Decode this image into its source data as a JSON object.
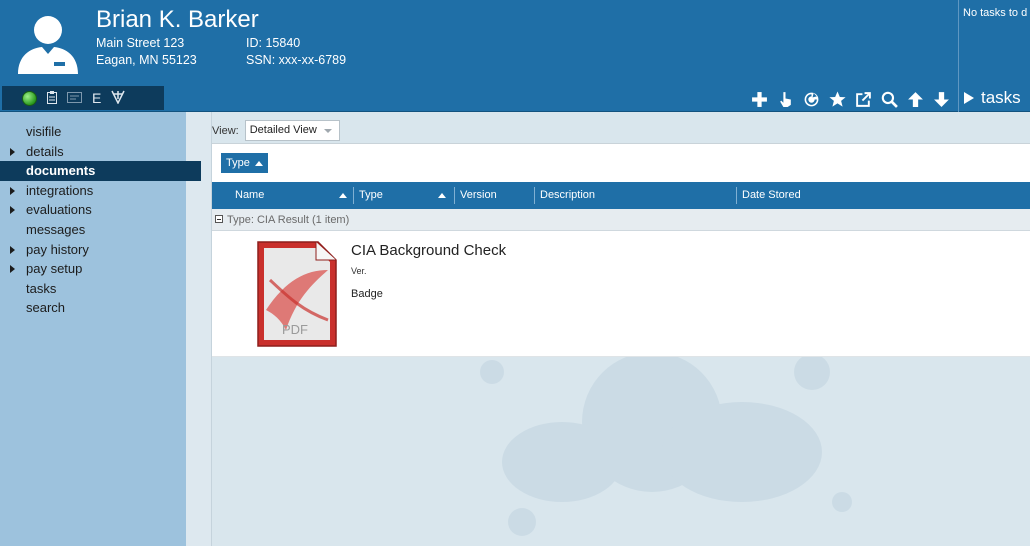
{
  "employee": {
    "name": "Brian K. Barker",
    "address_line1": "Main Street 123",
    "address_line2": "Eagan, MN 55123",
    "id_label": "ID:",
    "id_value": "15840",
    "ssn_label": "SSN:",
    "ssn_value": "xxx-xx-6789"
  },
  "status_bar": {
    "letter": "E"
  },
  "toolbar": [
    "add-icon",
    "pointer-icon",
    "refresh-icon",
    "star-icon",
    "export-icon",
    "search-icon",
    "arrow-up-icon",
    "arrow-down-icon"
  ],
  "tasks": {
    "message": "No tasks to d",
    "button_label": "tasks"
  },
  "sidebar": {
    "items": [
      {
        "label": "visifile",
        "expandable": false,
        "active": false
      },
      {
        "label": "details",
        "expandable": true,
        "active": false
      },
      {
        "label": "documents",
        "expandable": false,
        "active": true
      },
      {
        "label": "integrations",
        "expandable": true,
        "active": false
      },
      {
        "label": "evaluations",
        "expandable": true,
        "active": false
      },
      {
        "label": "messages",
        "expandable": false,
        "active": false
      },
      {
        "label": "pay history",
        "expandable": true,
        "active": false
      },
      {
        "label": "pay setup",
        "expandable": true,
        "active": false
      },
      {
        "label": "tasks",
        "expandable": false,
        "active": false
      },
      {
        "label": "search",
        "expandable": false,
        "active": false
      }
    ]
  },
  "view": {
    "label": "View:",
    "selected": "Detailed View"
  },
  "grid": {
    "group_chip": "Type",
    "columns": [
      "Name",
      "Type",
      "Version",
      "Description",
      "Date Stored"
    ],
    "group_row": "Type: CIA Result (1 item)",
    "document": {
      "title": "CIA Background Check",
      "version": "Ver.",
      "description": "Badge",
      "icon_text": "PDF"
    }
  },
  "colors": {
    "header": "#1f6fa7",
    "dark_nav": "#0d3b5c",
    "sidebar": "#9dc2dd",
    "content_bg": "#d9e6ed"
  }
}
